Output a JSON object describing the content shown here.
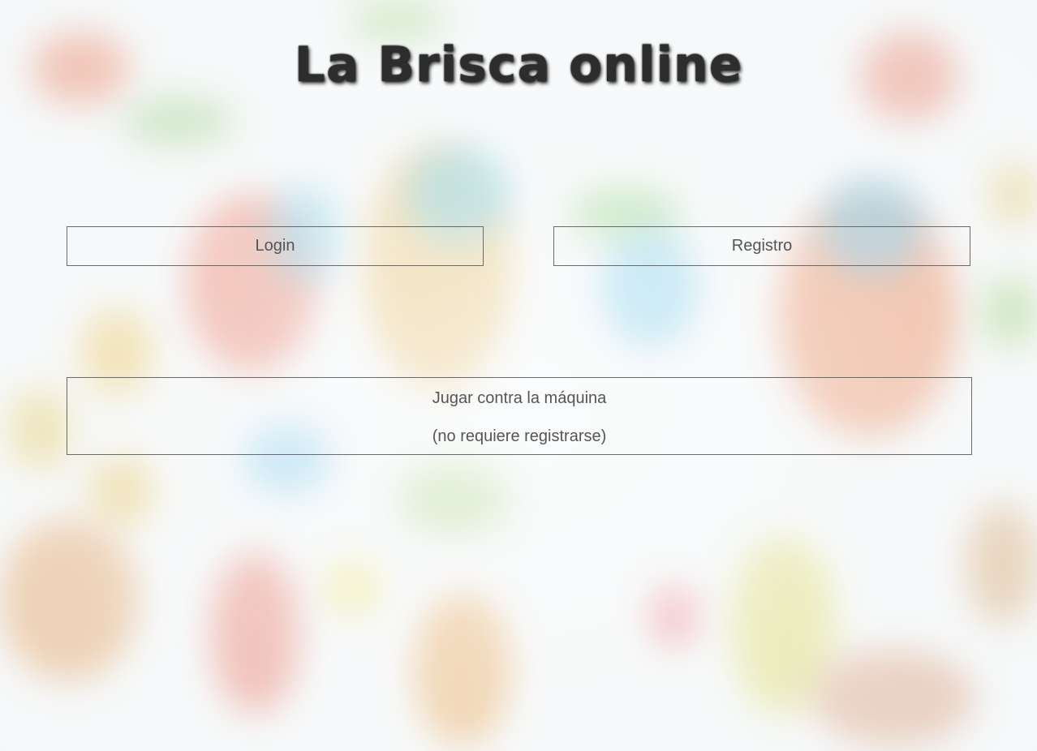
{
  "page": {
    "title": "La Brisca online"
  },
  "actions": {
    "login_label": "Login",
    "register_label": "Registro",
    "play_machine_label": "Jugar contra la máquina",
    "play_machine_note": "(no requiere registrarse)"
  },
  "theme": {
    "text_color": "#555555",
    "border_color": "#6a6a6a",
    "title_color": "#2d2d2d"
  }
}
